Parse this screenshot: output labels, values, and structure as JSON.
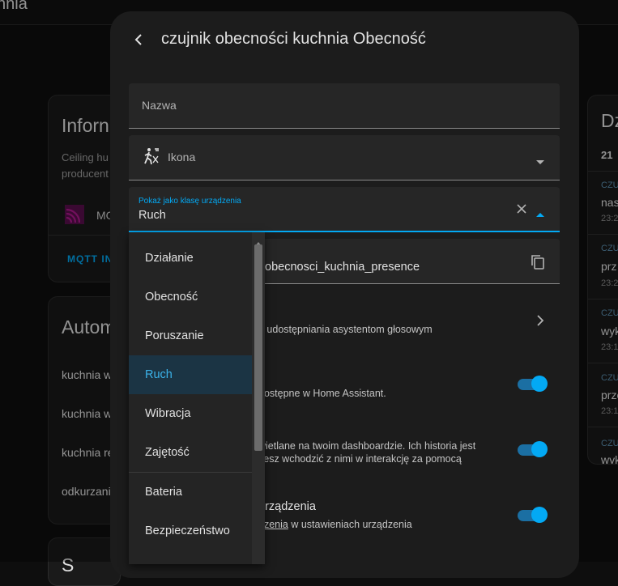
{
  "topbar": {
    "title": "hnia"
  },
  "left_card1": {
    "title": "Inforn",
    "desc1": "Ceiling hu",
    "desc2": "producent",
    "device": "MO",
    "action": "MQTT IN"
  },
  "left_card2": {
    "title": "Autom",
    "items": [
      "kuchnia w",
      "kuchnia w",
      "kuchnia re",
      "odkurzani"
    ]
  },
  "left_card3": {
    "title": "S"
  },
  "right_card": {
    "title": "Dz",
    "count": "21",
    "entries": [
      {
        "cat": "CZUJ",
        "text": "nas",
        "time": "23:2"
      },
      {
        "cat": "CZUJ",
        "text": "prz",
        "time": "23:2"
      },
      {
        "cat": "CZUJ",
        "text": "wyk",
        "time": "23:1"
      },
      {
        "cat": "CZUJ",
        "text": "prze",
        "time": "23:1"
      },
      {
        "cat": "CZUJ",
        "text": "wyk",
        "time": ""
      }
    ]
  },
  "dialog": {
    "title": "czujnik obecności kuchnia Obecność",
    "name_label": "Nazwa",
    "icon_label": "Ikona",
    "device_class": {
      "label": "Pokaż jako klasę urządzenia",
      "value": "Ruch"
    },
    "entity_id": "obecnosci_kuchnia_presence",
    "voice_text": "e udostępniania asystentom głosowym",
    "enabled_text": "dostępne w Home Assistant.",
    "visible_text1": "wietlane na twoim dashboardzie. Ich historia jest",
    "visible_text2": "żesz wchodzić z nimi w interakcję za pomocą",
    "area_title": "urządzenia",
    "area_link": "dzenia",
    "area_rest": " w ustawieniach urządzenia"
  },
  "menu": {
    "items": [
      "Działanie",
      "Obecność",
      "Poruszanie",
      "Ruch",
      "Wibracja",
      "Zajętość",
      "Bateria",
      "Bezpieczeństwo"
    ],
    "selected": "Ruch"
  },
  "colors": {
    "accent": "#03a9f4",
    "selected_bg": "#1b3444",
    "dialog_bg": "#1c1c1c"
  }
}
